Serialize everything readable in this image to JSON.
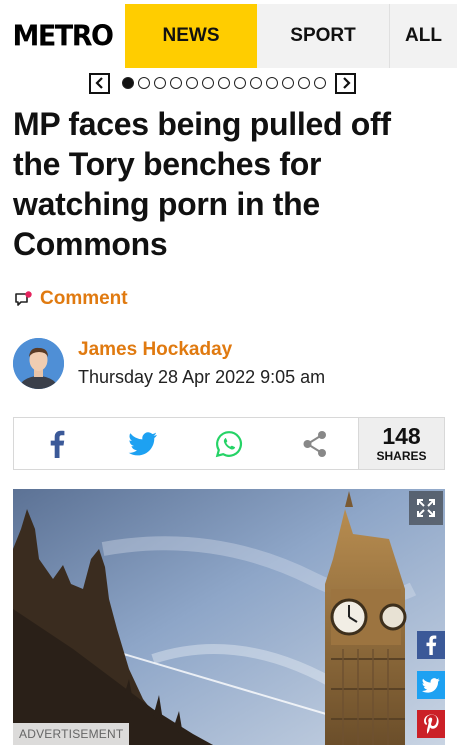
{
  "header": {
    "logo": "METRO",
    "nav": [
      {
        "label": "NEWS"
      },
      {
        "label": "SPORT"
      },
      {
        "label": "ALL"
      }
    ]
  },
  "pager": {
    "prev": "<",
    "next": ">",
    "total_dots": 13,
    "active_index": 0
  },
  "article": {
    "headline": "MP faces being pulled off the Tory benches for watching porn in the Commons",
    "comment_label": "Comment",
    "author": "James Hockaday",
    "date": "Thursday 28 Apr 2022 9:05 am"
  },
  "share": {
    "count": "148",
    "count_label": "SHARES",
    "icons": [
      "facebook-icon",
      "twitter-icon",
      "whatsapp-icon",
      "share-icon"
    ]
  },
  "image": {
    "advert_label": "ADVERTISEMENT",
    "side_icons": [
      "facebook-icon",
      "twitter-icon",
      "pinterest-icon"
    ]
  },
  "colors": {
    "accent_yellow": "#ffcd00",
    "author_orange": "#e07a10",
    "facebook": "#3b5998",
    "twitter": "#1da1f2",
    "whatsapp": "#25d366",
    "pinterest": "#cb2027"
  }
}
